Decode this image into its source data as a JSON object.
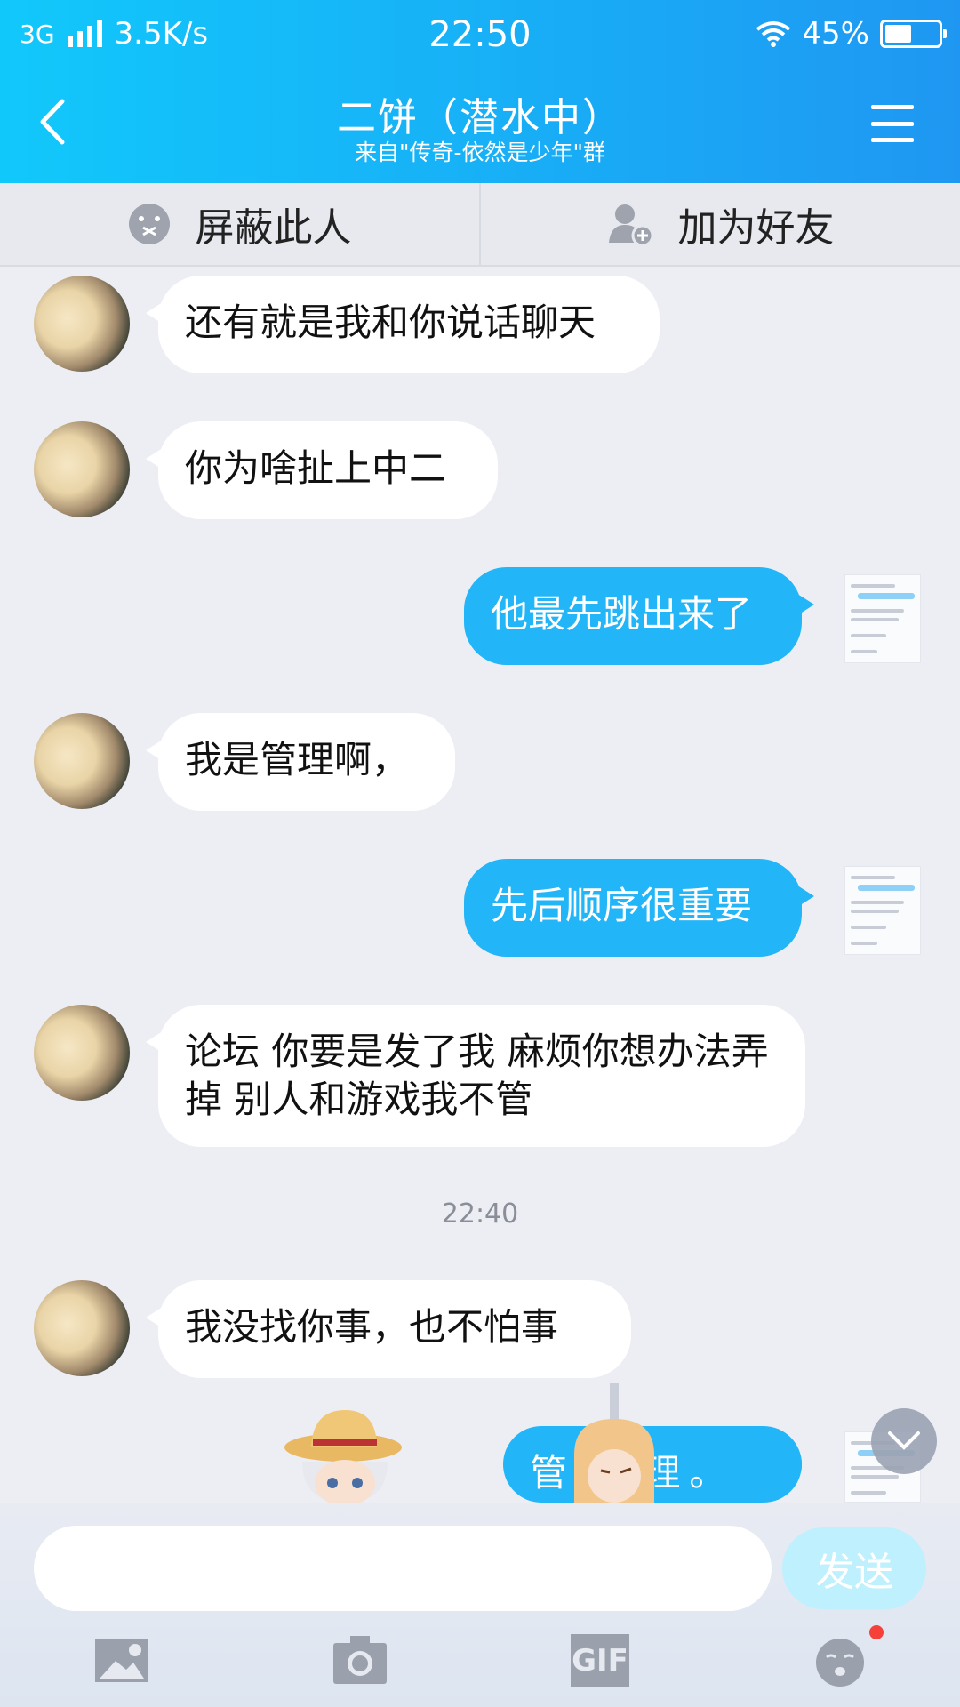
{
  "status_bar": {
    "network": "3G",
    "speed": "3.5K/s",
    "time": "22:50",
    "battery": "45%"
  },
  "nav": {
    "title": "二饼（潜水中）",
    "subtitle": "来自\"传奇-依然是少年\"群"
  },
  "actions": {
    "block": "屏蔽此人",
    "add_friend": "加为好友"
  },
  "messages": [
    {
      "direction": "in",
      "text": "还有就是我和你说话聊天"
    },
    {
      "direction": "in",
      "text": "你为啥扯上中二"
    },
    {
      "direction": "out",
      "text": "他最先跳出来了"
    },
    {
      "direction": "in",
      "text": "我是管理啊，"
    },
    {
      "direction": "out",
      "text": "先后顺序很重要"
    },
    {
      "direction": "in",
      "text": "论坛 你要是发了我 麻烦你想办法弄掉 别人和游戏我不管"
    },
    {
      "direction": "in",
      "text": "我没找你事，也不怕事"
    },
    {
      "direction": "out",
      "text": "管 管理。"
    }
  ],
  "timestamp": "22:40",
  "input": {
    "placeholder": "",
    "send_label": "发送"
  },
  "toolbar": {
    "gif_label": "GIF"
  },
  "colors": {
    "header": "#18aef6",
    "outgoing_bubble": "#22b5f8",
    "incoming_bubble": "#ffffff",
    "badge": "#f5413a"
  }
}
